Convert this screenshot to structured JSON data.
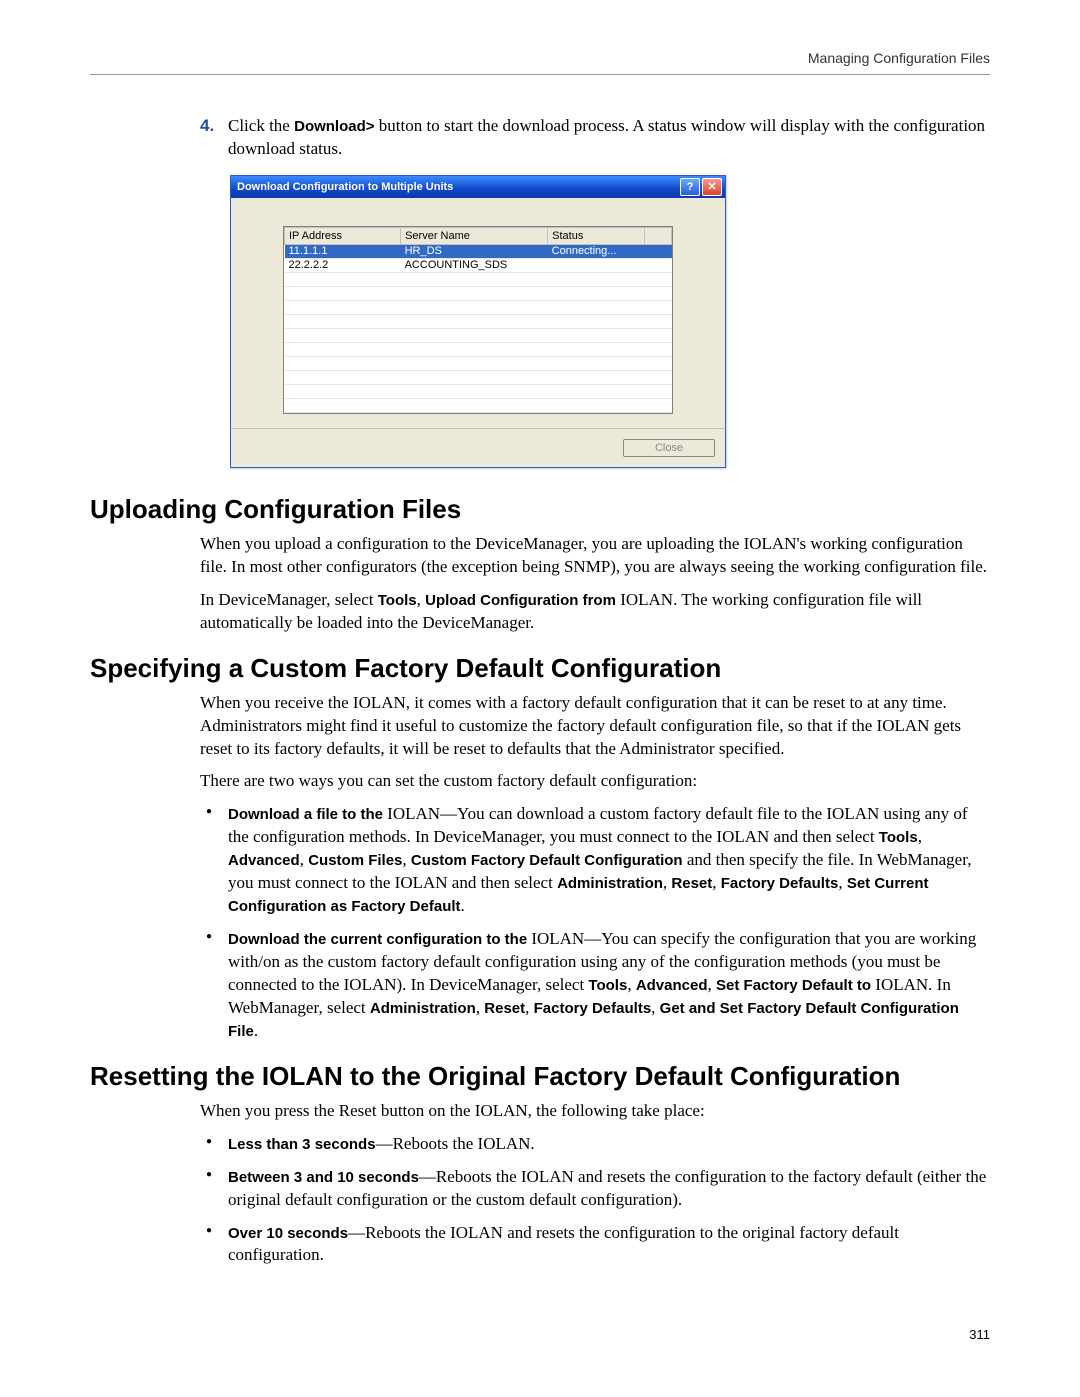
{
  "header": {
    "running": "Managing Configuration Files"
  },
  "step4": {
    "num": "4.",
    "pre": "Click the ",
    "button": "Download>",
    "post": " button to start the download process. A status window will display with the configuration download status."
  },
  "dialog": {
    "title": "Download Configuration to Multiple Units",
    "help": "?",
    "close": "✕",
    "cols": {
      "ip": "IP Address",
      "server": "Server Name",
      "status": "Status"
    },
    "rows": [
      {
        "ip": "11.1.1.1",
        "server": "HR_DS",
        "status": "Connecting...",
        "sel": true
      },
      {
        "ip": "22.2.2.2",
        "server": "ACCOUNTING_SDS",
        "status": "",
        "sel": false
      }
    ],
    "closeBtn": "Close"
  },
  "sec1": {
    "title": "Uploading Configuration Files",
    "p1": "When you upload a configuration to the DeviceManager, you are uploading the IOLAN's working configuration file. In most other configurators (the exception being SNMP), you are always seeing the working configuration file.",
    "p2a": "In DeviceManager, select ",
    "p2b_tools": "Tools",
    "p2b_sep": ", ",
    "p2b_upload": "Upload Configuration from",
    "p2c": " IOLAN. The working configuration file will automatically be loaded into the DeviceManager."
  },
  "sec2": {
    "title": "Specifying a Custom Factory Default Configuration",
    "p1": "When you receive the IOLAN, it comes with a factory default configuration that it can be reset to at any time. Administrators might find it useful to customize the factory default configuration file, so that if the IOLAN gets reset to its factory defaults, it will be reset to defaults that the Administrator specified.",
    "p2": "There are two ways you can set the custom factory default configuration:",
    "b1": {
      "lead": "Download a file to the ",
      "t1": "IOLAN—You can download a custom factory default file to the IOLAN using any of the configuration methods. In DeviceManager, you must connect to the IOLAN and then select ",
      "m1": "Tools",
      "m2": "Advanced",
      "m3": "Custom Files",
      "m4": "Custom Factory Default Configuration",
      "t2": " and then specify the file. In WebManager, you must connect to the IOLAN and then select ",
      "m5": "Administration",
      "m6": "Reset",
      "m7": "Factory Defaults",
      "m8": "Set Current Configuration as Factory Default",
      "end": "."
    },
    "b2": {
      "lead": "Download the current configuration to the ",
      "t1": "IOLAN—You can specify the configuration that you are working with/on as the custom factory default configuration using any of the configuration methods (you must be connected to the IOLAN). In DeviceManager, select ",
      "m1": "Tools",
      "m2": "Advanced",
      "m3": "Set Factory Default to",
      "t2": " IOLAN. In WebManager, select ",
      "m4": "Administration",
      "m5": "Reset",
      "m6": "Factory Defaults",
      "m7": "Get and Set Factory Default Configuration File",
      "end": "."
    }
  },
  "sec3": {
    "title": "Resetting the IOLAN to the Original Factory Default Configuration",
    "p1": "When you press the Reset button on the IOLAN, the following take place:",
    "b1a": "Less than 3 seconds",
    "b1b": "—Reboots the IOLAN.",
    "b2a": "Between 3 and 10 seconds",
    "b2b": "—Reboots the IOLAN and resets the configuration to the factory default (either the original default configuration or the custom default configuration).",
    "b3a": "Over 10 seconds",
    "b3b": "—Reboots the IOLAN and resets the configuration to the original factory default configuration."
  },
  "pageNumber": "311",
  "sep": ", "
}
